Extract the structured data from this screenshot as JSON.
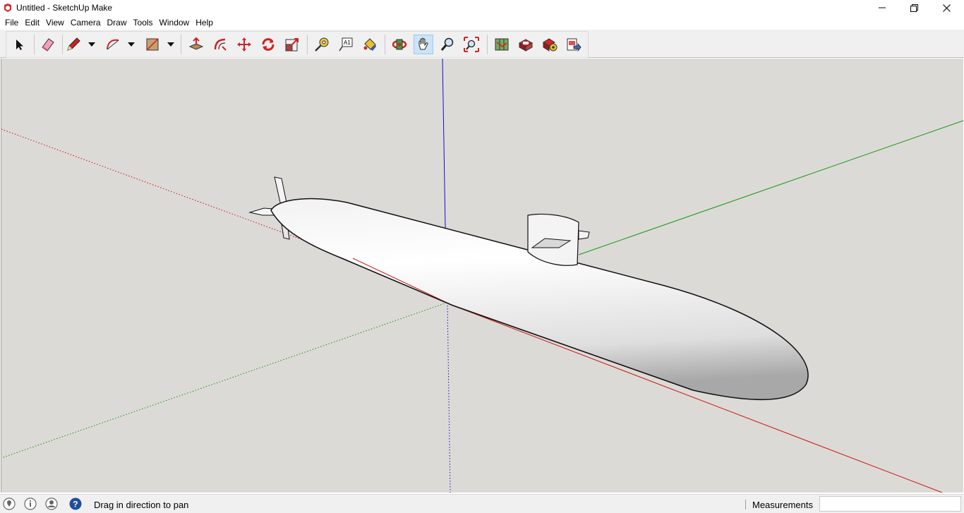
{
  "window": {
    "title": "Untitled - SketchUp Make",
    "icon": "sketchup-logo-icon",
    "controls": [
      "minimize-icon",
      "restore-icon",
      "close-icon"
    ]
  },
  "menu": {
    "items": [
      "File",
      "Edit",
      "View",
      "Camera",
      "Draw",
      "Tools",
      "Window",
      "Help"
    ]
  },
  "toolbar": {
    "tools": [
      {
        "name": "select-tool",
        "icon": "arrow-cursor-icon"
      },
      {
        "name": "eraser-tool",
        "icon": "eraser-icon"
      },
      {
        "name": "line-tool",
        "icon": "pencil-icon",
        "dropdown": true
      },
      {
        "name": "arc-tool",
        "icon": "arc-icon",
        "dropdown": true
      },
      {
        "name": "rectangle-tool",
        "icon": "rectangle-icon",
        "dropdown": true
      },
      {
        "name": "push-pull-tool",
        "icon": "push-pull-icon"
      },
      {
        "name": "offset-tool",
        "icon": "offset-icon"
      },
      {
        "name": "move-tool",
        "icon": "move-arrows-icon"
      },
      {
        "name": "rotate-tool",
        "icon": "rotate-icon"
      },
      {
        "name": "scale-tool",
        "icon": "scale-icon"
      },
      {
        "name": "tape-measure-tool",
        "icon": "tape-measure-icon"
      },
      {
        "name": "text-tool",
        "icon": "text-a1-icon"
      },
      {
        "name": "paint-bucket-tool",
        "icon": "paint-bucket-icon"
      },
      {
        "name": "orbit-tool",
        "icon": "orbit-icon"
      },
      {
        "name": "pan-tool",
        "icon": "hand-icon",
        "active": true
      },
      {
        "name": "zoom-tool",
        "icon": "magnifier-icon"
      },
      {
        "name": "zoom-extents-tool",
        "icon": "zoom-extents-icon"
      },
      {
        "name": "3d-warehouse-button",
        "icon": "warehouse-map-icon"
      },
      {
        "name": "share-model-button",
        "icon": "share-model-icon"
      },
      {
        "name": "extension-warehouse-button",
        "icon": "extension-warehouse-icon"
      },
      {
        "name": "send-to-layout-button",
        "icon": "send-to-layout-icon"
      }
    ]
  },
  "viewport": {
    "background": "#dcdad6",
    "axis_colors": {
      "x": "#cc1111",
      "y": "#119911",
      "z": "#1111cc"
    },
    "model": "submarine"
  },
  "status": {
    "icons": [
      "geo-location-icon",
      "credits-icon",
      "user-account-icon",
      "help-icon"
    ],
    "message": "Drag in direction to pan",
    "measurements_label": "Measurements",
    "measurements_value": ""
  }
}
